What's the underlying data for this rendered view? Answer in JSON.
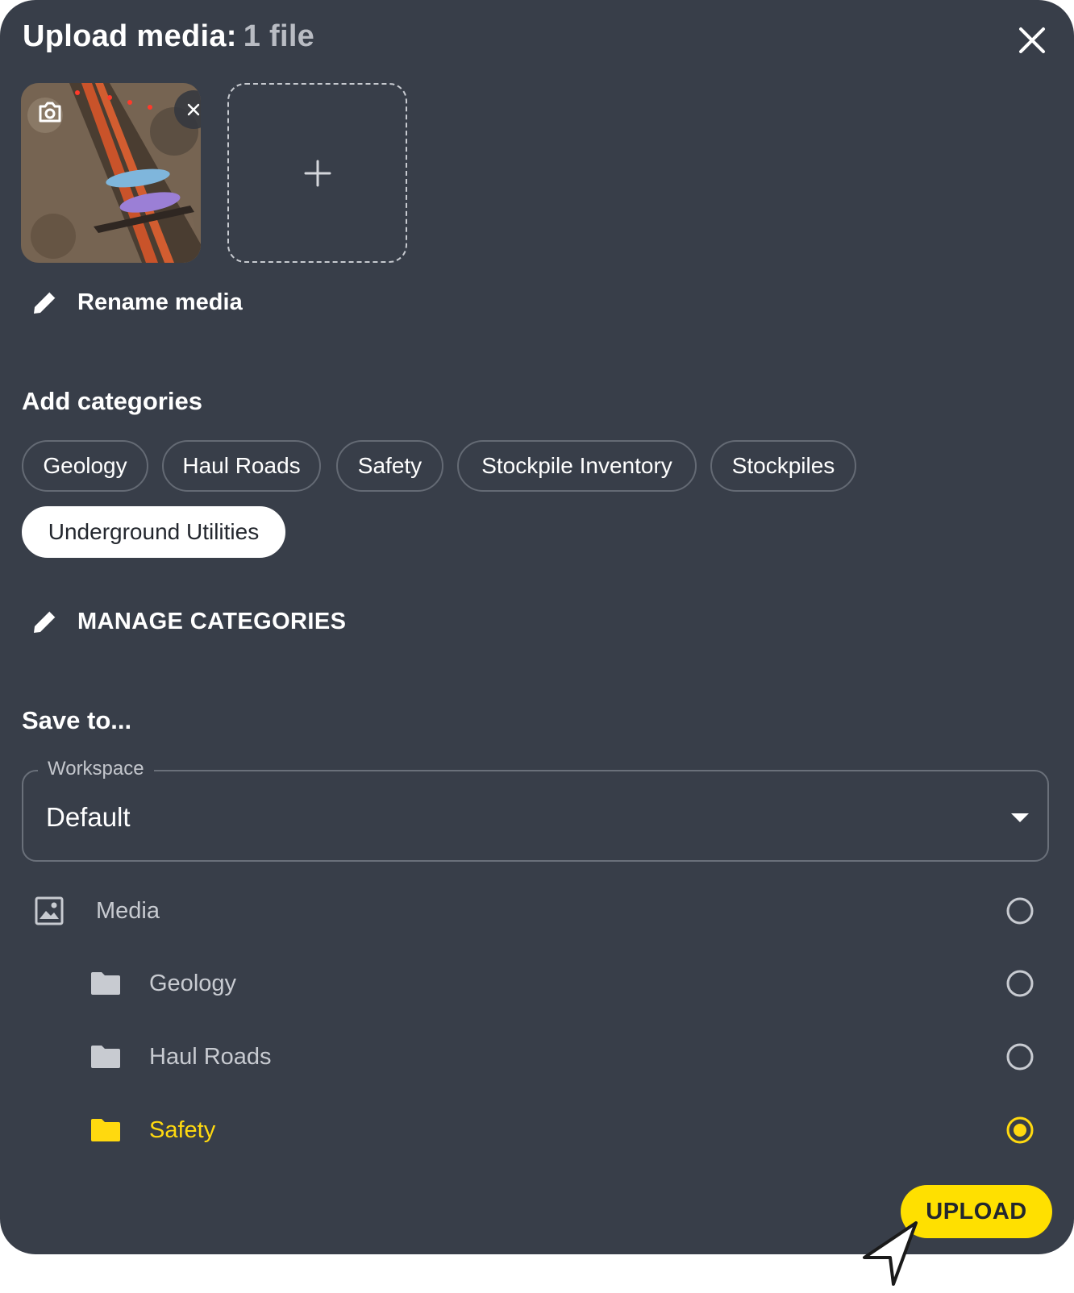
{
  "dialog": {
    "title": "Upload media:",
    "file_count": "1 file",
    "close_icon": "close-icon"
  },
  "media": {
    "thumbnail_icon": "camera-icon",
    "remove_icon": "close-icon",
    "add_icon": "plus-icon",
    "rename_label": "Rename media"
  },
  "categories": {
    "heading": "Add categories",
    "chips": [
      {
        "label": "Geology",
        "selected": false
      },
      {
        "label": "Haul Roads",
        "selected": false
      },
      {
        "label": "Safety",
        "selected": false
      },
      {
        "label": "Stockpile Inventory",
        "selected": false
      },
      {
        "label": "Stockpiles",
        "selected": false
      },
      {
        "label": "Underground Utilities",
        "selected": true
      }
    ],
    "manage_label": "MANAGE CATEGORIES"
  },
  "save_to": {
    "heading": "Save to...",
    "workspace_label": "Workspace",
    "workspace_value": "Default",
    "tree": [
      {
        "label": "Media",
        "icon": "image-icon",
        "selected": false
      },
      {
        "label": "Geology",
        "icon": "folder-icon",
        "selected": false
      },
      {
        "label": "Haul Roads",
        "icon": "folder-icon",
        "selected": false
      },
      {
        "label": "Safety",
        "icon": "folder-icon",
        "selected": true
      }
    ]
  },
  "actions": {
    "upload_label": "UPLOAD"
  },
  "colors": {
    "background": "#383e49",
    "accent": "#ffe000",
    "active_text": "#ffd90f"
  }
}
